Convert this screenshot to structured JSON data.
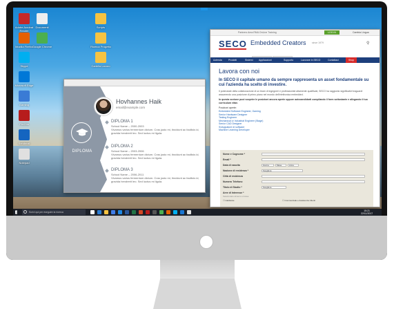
{
  "desktop": {
    "icons_left": [
      {
        "label": "Adobe Acrobat Reader",
        "icon": "pdf-icon",
        "color": "#c62828"
      },
      {
        "label": "Mozilla Firefox",
        "icon": "firefox-icon",
        "color": "#e66000"
      },
      {
        "label": "Skype",
        "icon": "skype-icon",
        "color": "#00aff0"
      },
      {
        "label": "Microsoft Edge",
        "icon": "edge-icon",
        "color": "#0078d7"
      },
      {
        "label": "Gaming",
        "icon": "gamepad-icon",
        "color": "#3a7bd5"
      },
      {
        "label": "FileZilla",
        "icon": "filezilla-icon",
        "color": "#b71c1c"
      },
      {
        "label": "Sendmail",
        "icon": "mail-icon",
        "color": "#1565c0"
      },
      {
        "label": "Notepad",
        "icon": "note-icon",
        "color": "#e0e0e0"
      }
    ],
    "icons_col2": [
      {
        "label": "Documenti",
        "icon": "document-icon",
        "color": "#eeeeee"
      },
      {
        "label": "Google Chrome",
        "icon": "chrome-icon",
        "color": "#4caf50"
      }
    ],
    "icons_col3": [
      {
        "label": "Scripts",
        "icon": "folder-icon",
        "color": "#f6c342"
      },
      {
        "label": "Ricerca Progetto",
        "icon": "folder-icon",
        "color": "#f6c342"
      },
      {
        "label": "Cartella Lavoro",
        "icon": "folder-icon",
        "color": "#f6c342"
      }
    ]
  },
  "resume": {
    "name": "Hovhannes Haik",
    "email": "email@example.com",
    "side_label": "DIPLOMA",
    "items": [
      {
        "title": "DIPLOMA 1",
        "meta": "School Name – 2000-2003",
        "text": "Vivamus varius fermentum dictum. Cras justo mi, tincidunt ac facilisis id, gravida hendrerit leo. Sed luctus mi ligula."
      },
      {
        "title": "DIPLOMA 2",
        "meta": "School Name – 2003-2006",
        "text": "Vivamus varius fermentum dictum. Cras justo mi, tincidunt ac facilisis id, gravida hendrerit leo. Sed luctus mi ligula."
      },
      {
        "title": "DIPLOMA 3",
        "meta": "School Name – 2006-2011",
        "text": "Vivamus varius fermentum dictum. Cras justo mi, tincidunt ac facilisis id, gravida hendrerit leo. Sed luctus mi ligula."
      }
    ]
  },
  "browser": {
    "top_links": "Partners Area   RMA OnLine   Training",
    "login": "LOG IN",
    "language": "Cambia Lingua",
    "logo": "SECO",
    "tagline": "Embedded Creators",
    "since": "since 1979",
    "tabs": [
      "Embedded",
      "SECO Lab"
    ],
    "nav": [
      "Azienda",
      "Prodotti",
      "Sistemi",
      "Applicazioni",
      "Supporto",
      "Lavorare in SECO",
      "Contattaci",
      "Shop"
    ],
    "heading": "Lavora con noi",
    "subheading": "In SECO il capitale umano da sempre rappresenta un asset fondamentale su cui l'azienda ha scelto di investire.",
    "paragraph": "Il potenziale della collaborazione di un team di ingegneri e professionisti altamente qualificati, SECO ha raggiunto significativi traguardi assumendo una posizione di primo piano nel mondo dell'elettronica embedded.",
    "bold_text": "In questa sezione puoi scoprire le posizioni ancora aperte oppure autocandidarti compilando il form sottostante e allegando il tuo curriculum vitae.",
    "positions_label": "Posizioni aperte:",
    "positions": [
      "Embedded Software Engineer, Gaming",
      "Senior Hardware Designer",
      "Testing Engineer",
      "Mechanical or Industrial Engineer (Stage)",
      "Senior CAD Designer",
      "Sviluppatore di software",
      "Machine Learning Developer"
    ],
    "form": {
      "name_label": "Nome e Cognome *",
      "email_label": "Email *",
      "birth_label": "Data di nascita",
      "birth_day": "Giorno",
      "birth_month": "Mese",
      "birth_year": "Anno",
      "nation_label": "Nazione di residenza *",
      "nation_value": "Scegliere",
      "city_label": "Città di residenza",
      "phone_label": "Numero Telefono",
      "study_label": "Titolo di Studio *",
      "study_value": "Scegliere",
      "interest_label": "Aree di Interesse *",
      "interest_hint": "Selezionare almeno un'area",
      "options": [
        "Hardware",
        "Commerciale e Assistenza Clienti"
      ]
    }
  },
  "taskbar": {
    "search_placeholder": "Scrivi qui per eseguire la ricerca",
    "time": "15:21",
    "date": "22/11/2017",
    "apps": [
      {
        "icon": "task-view-icon",
        "color": "#ffffff"
      },
      {
        "icon": "edge-icon",
        "color": "#2b7cd3"
      },
      {
        "icon": "folder-icon",
        "color": "#f6c342"
      },
      {
        "icon": "store-icon",
        "color": "#3f7de8"
      },
      {
        "icon": "mail-icon",
        "color": "#1e88e5"
      },
      {
        "icon": "word-icon",
        "color": "#2b579a"
      },
      {
        "icon": "excel-icon",
        "color": "#217346"
      },
      {
        "icon": "powerpoint-icon",
        "color": "#d24726"
      },
      {
        "icon": "filezilla-icon",
        "color": "#b71c1c"
      },
      {
        "icon": "terminal-icon",
        "color": "#555555"
      },
      {
        "icon": "chrome-icon",
        "color": "#4caf50"
      },
      {
        "icon": "firefox-icon",
        "color": "#e66000"
      },
      {
        "icon": "skype-icon",
        "color": "#00aff0"
      },
      {
        "icon": "photos-icon",
        "color": "#1976d2"
      },
      {
        "icon": "settings-icon",
        "color": "#e0e0e0"
      }
    ]
  }
}
